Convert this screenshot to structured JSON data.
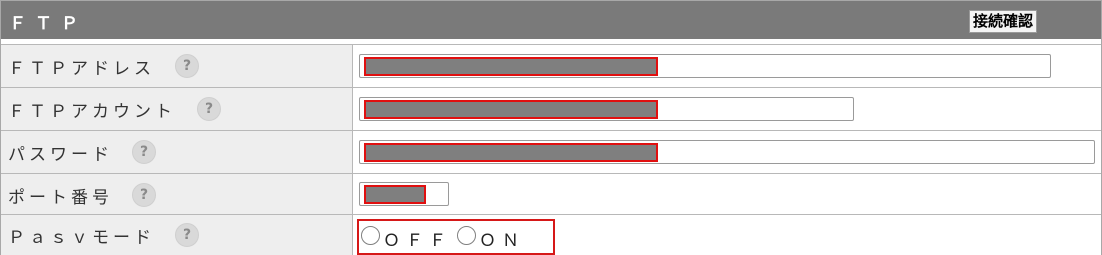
{
  "header": {
    "title": "ＦＴＰ",
    "check_button": "接続確認"
  },
  "rows": [
    {
      "label": "ＦＴＰアドレス"
    },
    {
      "label": "ＦＴＰアカウント"
    },
    {
      "label": "パスワード"
    },
    {
      "label": "ポート番号"
    },
    {
      "label": "Ｐａｓｖモード"
    }
  ],
  "help_glyph": "?",
  "pasv": {
    "off_label": "ＯＦＦ",
    "on_label": "ＯＮ"
  },
  "colors": {
    "header_bg": "#7a7a7a",
    "label_bg": "#eeeeee",
    "redact": "#7f7f7f",
    "highlight": "#e01010"
  }
}
